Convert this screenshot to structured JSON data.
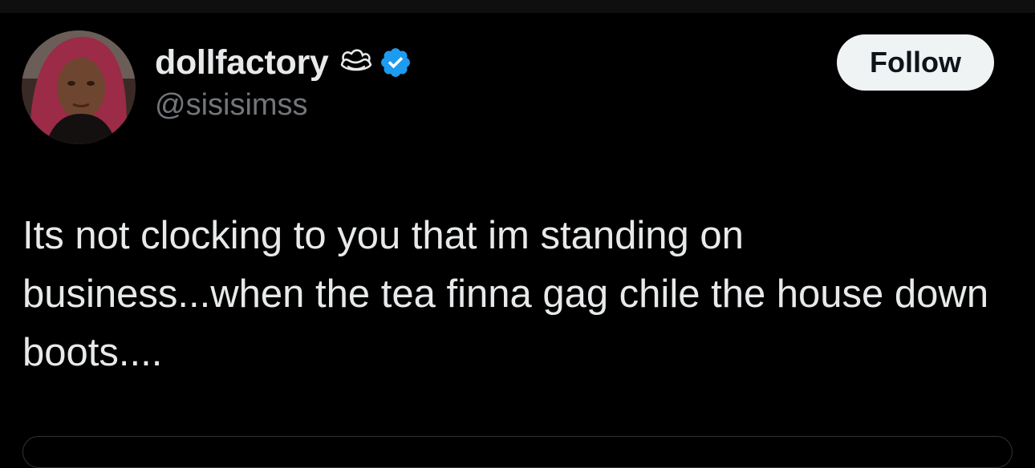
{
  "user": {
    "display_name": "dollfactory",
    "handle": "@sisisimss",
    "name_emoji_icon": "cowboy-hat-icon",
    "verified_icon": "verified-badge-icon"
  },
  "follow_button": {
    "label": "Follow"
  },
  "tweet": {
    "text": "Its not clocking to you that im standing on business...when the tea finna gag chile the house down boots...."
  },
  "colors": {
    "background": "#000000",
    "primary_text": "#e7e9ea",
    "secondary_text": "#71767b",
    "verified_blue": "#1d9bf0",
    "follow_bg": "#eff3f4",
    "follow_text": "#0f1419"
  }
}
